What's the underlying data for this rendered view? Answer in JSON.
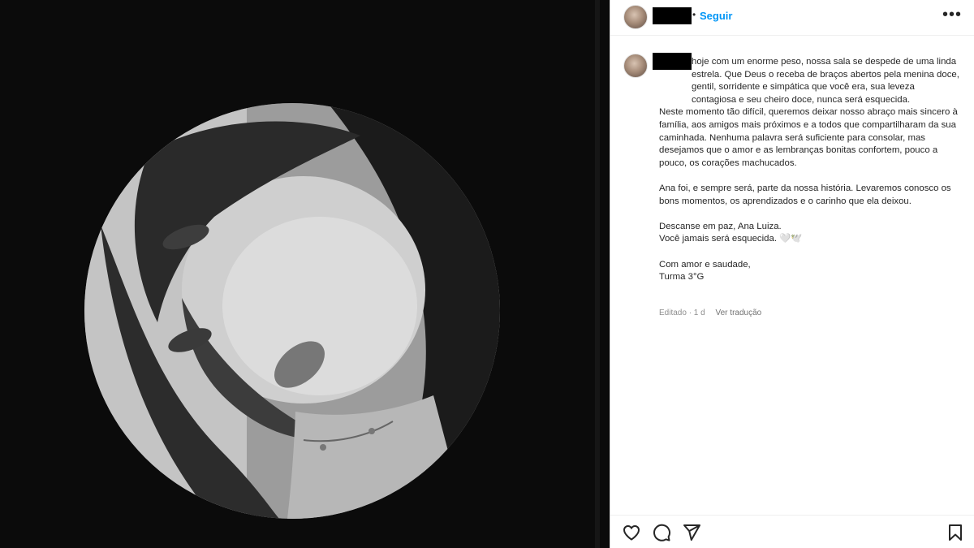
{
  "post": {
    "header": {
      "follow_label": "Seguir",
      "separator": "•",
      "more_label": "•••"
    },
    "caption": {
      "line_1": "hoje com um enorme peso, nossa sala se despede de uma linda estrela. Que Deus o receba de braços abertos pela menina doce, gentil, sorridente e simpática que você era, sua leveza contagiosa e seu cheiro doce, nunca será esquecida.",
      "paragraph_1b": "Neste momento tão difícil, queremos deixar nosso abraço mais sincero à família, aos amigos mais próximos e a todos que compartilharam da sua caminhada. Nenhuma palavra será suficiente para consolar, mas desejamos que o amor e as lembranças bonitas confortem, pouco a pouco, os corações machucados.",
      "paragraph_2": "Ana foi, e sempre será, parte da nossa história. Levaremos conosco os bons momentos, os aprendizados e o carinho que ela deixou.",
      "paragraph_3a": "Descanse em paz, Ana Luiza.",
      "paragraph_3b": "Você jamais será esquecida. 🤍🕊️",
      "paragraph_4a": "Com amor e saudade,",
      "paragraph_4b": "Turma 3°G"
    },
    "meta": {
      "edited": "Editado · 1 d",
      "translate": "Ver tradução"
    },
    "actions": {
      "like_icon": "heart-icon",
      "comment_icon": "comment-icon",
      "share_icon": "paper-plane-icon",
      "save_icon": "bookmark-icon"
    }
  },
  "colors": {
    "follow_blue": "#0095f6",
    "text": "#262626",
    "muted": "#8e8e8e"
  }
}
